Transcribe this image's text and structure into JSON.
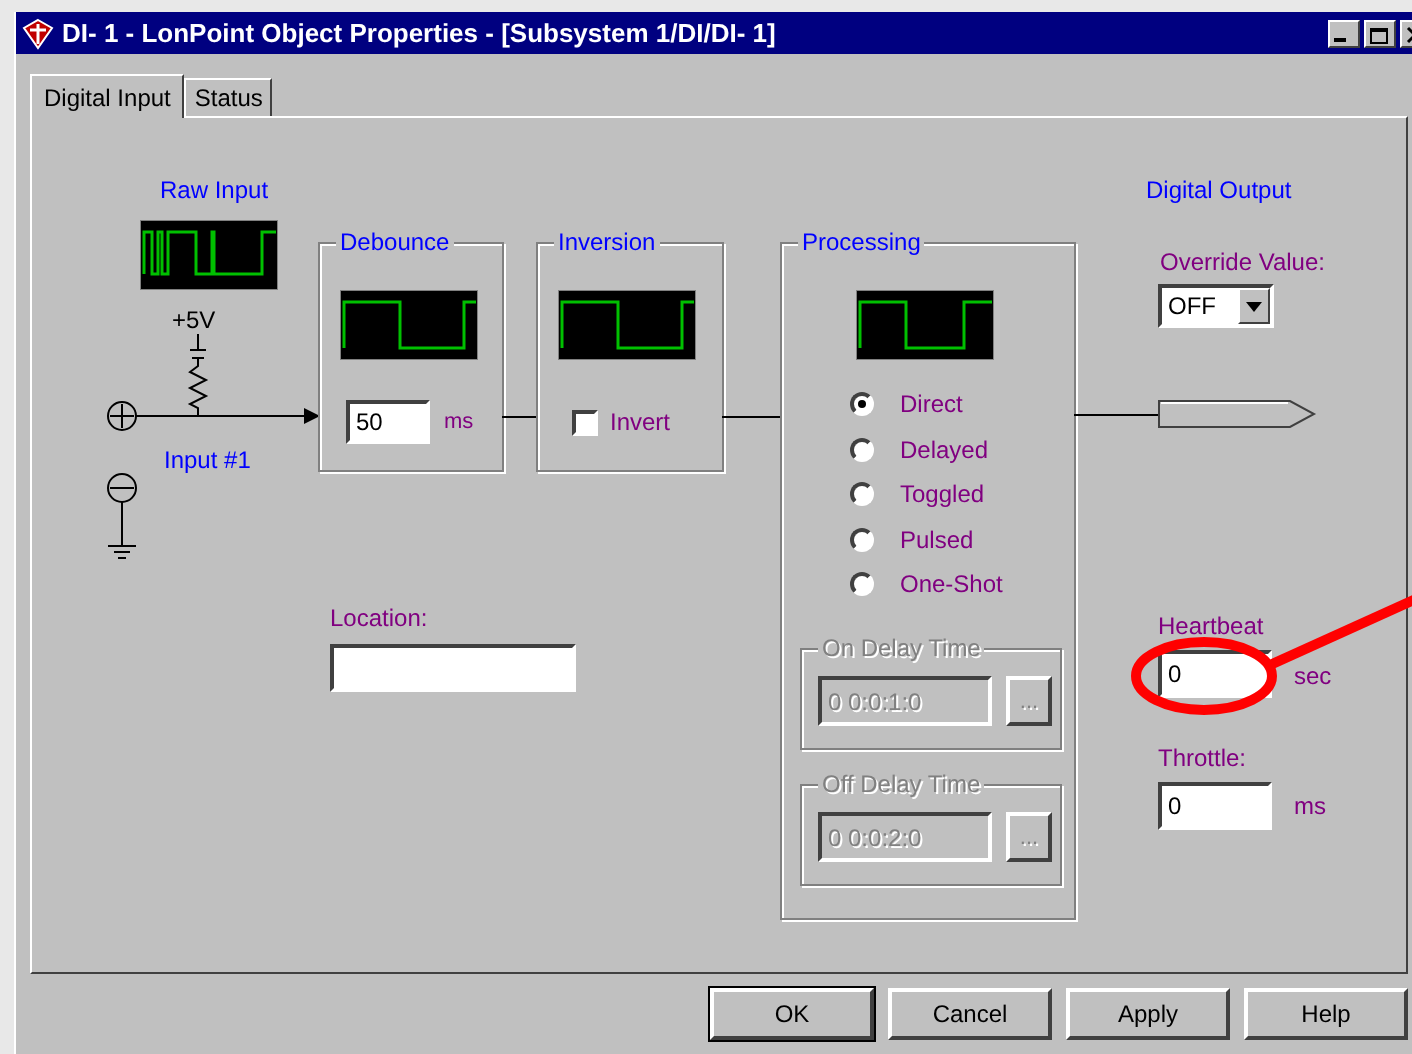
{
  "window": {
    "title": "DI- 1 - LonPoint Object Properties - [Subsystem 1/DI/DI- 1]"
  },
  "tabs": [
    {
      "label": "Digital Input",
      "selected": true
    },
    {
      "label": "Status",
      "selected": false
    }
  ],
  "raw_input": {
    "label": "Raw Input",
    "supply": "+5V",
    "input_label": "Input #1"
  },
  "debounce": {
    "title": "Debounce",
    "value": "50",
    "unit": "ms"
  },
  "inversion": {
    "title": "Inversion",
    "invert": {
      "label": "Invert",
      "checked": false
    }
  },
  "processing": {
    "title": "Processing",
    "modes": [
      {
        "label": "Direct",
        "selected": true
      },
      {
        "label": "Delayed",
        "selected": false
      },
      {
        "label": "Toggled",
        "selected": false
      },
      {
        "label": "Pulsed",
        "selected": false
      },
      {
        "label": "One-Shot",
        "selected": false
      }
    ],
    "delays": [
      {
        "title": "On Delay Time",
        "value": "0 0:0:1:0",
        "button": "...",
        "disabled": true
      },
      {
        "title": "Off Delay Time",
        "value": "0 0:0:2:0",
        "button": "...",
        "disabled": true
      }
    ]
  },
  "digital_output": {
    "label": "Digital Output",
    "override": {
      "label": "Override Value:",
      "value": "OFF"
    }
  },
  "location": {
    "label": "Location:"
  },
  "heartbeat": {
    "label": "Heartbeat",
    "value": "0",
    "unit": "sec"
  },
  "throttle": {
    "label": "Throttle:",
    "value": "0",
    "unit": "ms"
  },
  "buttons": [
    {
      "label": "OK",
      "default": true
    },
    {
      "label": "Cancel",
      "default": false
    },
    {
      "label": "Apply",
      "default": false
    },
    {
      "label": "Help",
      "default": false
    }
  ]
}
